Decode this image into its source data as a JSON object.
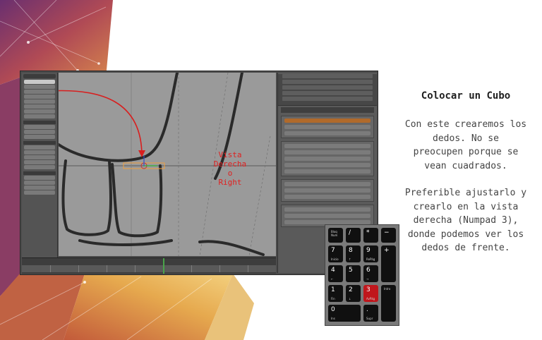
{
  "slide": {
    "title": "Colocar un Cubo",
    "paragraph1": "Con este crearemos los\ndedos. No se\npreocupen porque se\nvean cuadrados.",
    "paragraph2": "Preferible ajustarlo y\ncrearlo en la vista\nderecha (Numpad 3),\ndonde podemos ver los\ndedos de frente."
  },
  "annotation": {
    "lines": [
      "Vista",
      "Derecha",
      "o",
      "Right"
    ],
    "color": "#e02020"
  },
  "numpad": {
    "keys": [
      {
        "main": "",
        "top": "Bloq\nNum"
      },
      {
        "main": "/",
        "top": ""
      },
      {
        "main": "*",
        "top": ""
      },
      {
        "main": "−",
        "top": ""
      },
      {
        "main": "7",
        "sub": "Inicio"
      },
      {
        "main": "8",
        "sub": "↑"
      },
      {
        "main": "9",
        "sub": "RePág"
      },
      {
        "main": "+",
        "sub": ""
      },
      {
        "main": "4",
        "sub": "←"
      },
      {
        "main": "5",
        "sub": ""
      },
      {
        "main": "6",
        "sub": "→"
      },
      {
        "main": "1",
        "sub": "Fin"
      },
      {
        "main": "2",
        "sub": "↓"
      },
      {
        "main": "3",
        "sub": "AvPág"
      },
      {
        "main": "",
        "sub": "Intro"
      },
      {
        "main": "0",
        "sub": "Ins"
      },
      {
        "main": ".",
        "sub": "Supr"
      }
    ],
    "highlight_color": "#c0161c"
  },
  "colors": {
    "blender_bg": "#4b4b4b",
    "viewport_bg": "#9a9a9a"
  }
}
